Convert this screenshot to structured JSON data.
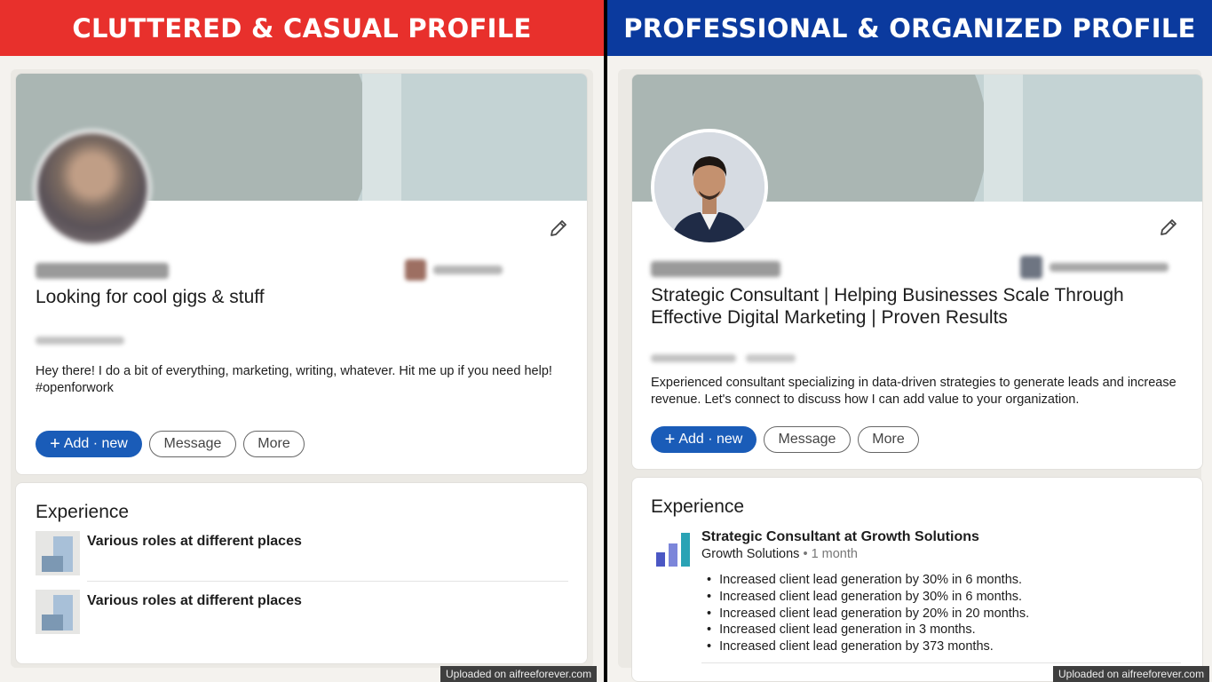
{
  "left": {
    "banner": "CLUTTERED & CASUAL PROFILE",
    "headline": "Looking for cool gigs & stuff",
    "about": "Hey there! I do a bit of everything, marketing, writing, whatever. Hit me up if you need help! #openforwork",
    "buttons": {
      "add": "Add · new",
      "message": "Message",
      "more": "More"
    },
    "experience": {
      "title": "Experience",
      "items": [
        {
          "title": "Various roles at different places"
        },
        {
          "title": "Various roles at different places"
        }
      ]
    }
  },
  "right": {
    "banner": "PROFESSIONAL & ORGANIZED PROFILE",
    "headline_line1": "Strategic Consultant | Helping Businesses Scale Through",
    "headline_line2": "Effective Digital Marketing | Proven Results",
    "about": "Experienced consultant specializing in data-driven strategies to generate leads and increase revenue. Let's connect to discuss how I can add value to your organization.",
    "buttons": {
      "add": "Add · new",
      "message": "Message",
      "more": "More"
    },
    "experience": {
      "title": "Experience",
      "job_title": "Strategic Consultant at Growth Solutions",
      "company": "Growth Solutions",
      "duration": "1 month",
      "bullets": [
        "Increased client lead generation by 30% in 6 months.",
        "Increased client lead generation by 30% in 6 months.",
        "Increased client lead generation by 20% in 20 months.",
        "Increased client lead generation in 3 months.",
        "Increased client lead generation by 373 months."
      ]
    }
  },
  "watermark": "Uploaded on aifreeforever.com",
  "colors": {
    "left_banner": "#e8302c",
    "right_banner": "#0b3a9e",
    "primary_button": "#1a5cb8"
  }
}
